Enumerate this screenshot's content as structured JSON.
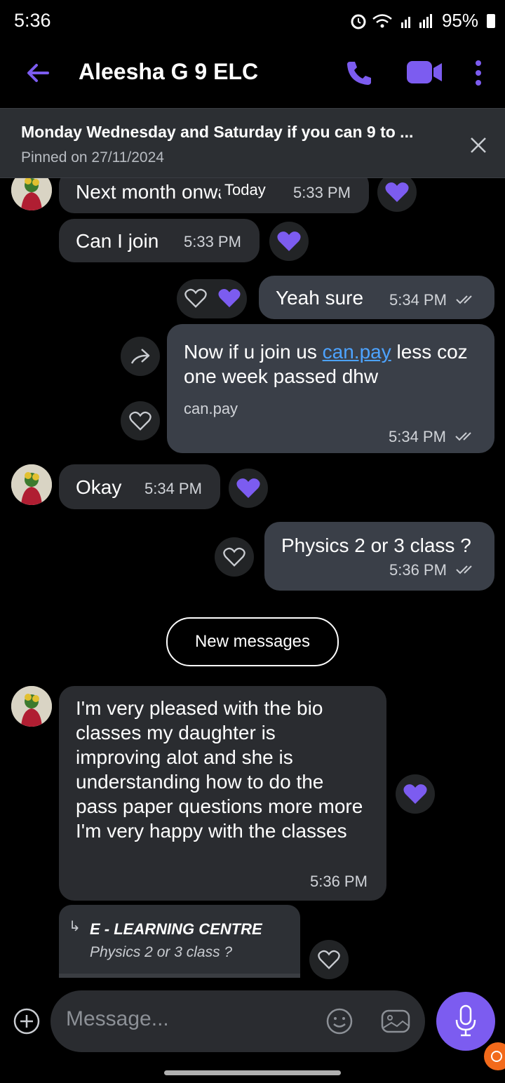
{
  "status": {
    "time": "5:36",
    "battery": "95%"
  },
  "header": {
    "title": "Aleesha G 9 ELC"
  },
  "pinned": {
    "text": "Monday Wednesday and Saturday if you can 9 to ...",
    "date": "Pinned on 27/11/2024"
  },
  "date_chip": "Today",
  "messages": [
    {
      "text": "Next month onwards",
      "time": "5:33 PM"
    },
    {
      "text": "Can I join",
      "time": "5:33 PM"
    },
    {
      "text": "Yeah sure",
      "time": "5:34 PM"
    },
    {
      "text_before": "Now if u join us ",
      "link": "can.pay",
      "text_after": " less coz one week passed dhw",
      "preview": "can.pay",
      "time": "5:34 PM"
    },
    {
      "text": "Okay",
      "time": "5:34 PM"
    },
    {
      "text": "Physics 2 or 3 class ?",
      "time": "5:36 PM"
    },
    {
      "text": "I'm very pleased with the bio classes my daughter is improving alot and she is understanding how to do the pass paper questions more more I'm very happy with the classes",
      "time": "5:36 PM"
    }
  ],
  "new_messages": "New messages",
  "reply": {
    "name": "E - LEARNING CENTRE",
    "text": "Physics 2 or 3 class ?"
  },
  "composer": {
    "placeholder": "Message..."
  },
  "colors": {
    "accent": "#7c5cf0",
    "link": "#4da3ff"
  }
}
